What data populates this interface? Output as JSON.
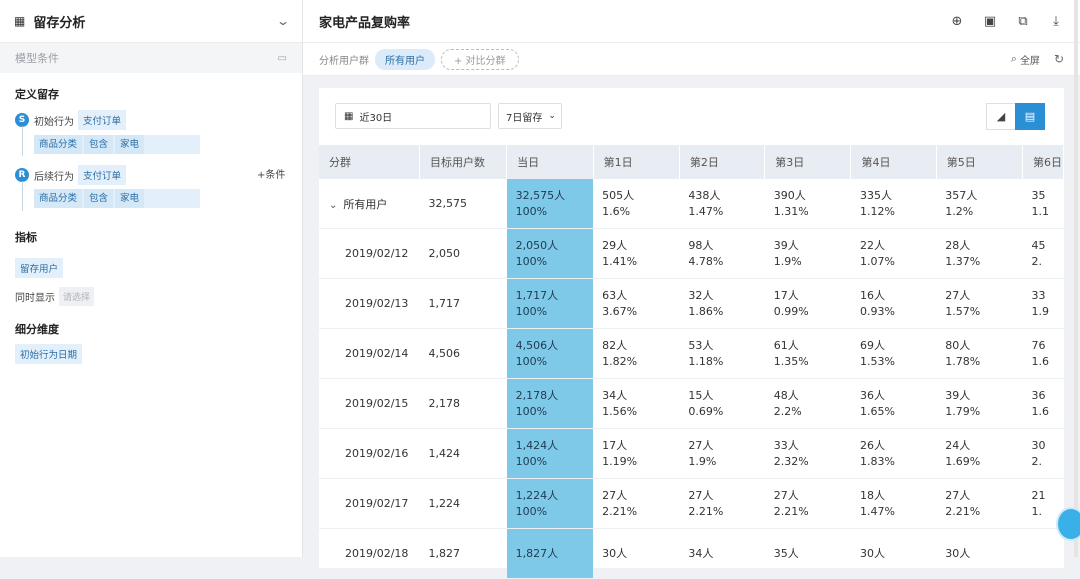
{
  "sidebar": {
    "title": "留存分析",
    "model_label": "模型条件",
    "define_label": "定义留存",
    "initial_badge": "S",
    "initial_label": "初始行为",
    "initial_event": "支付订单",
    "initial_filter": [
      "商品分类",
      "包含",
      "家电"
    ],
    "return_badge": "R",
    "return_label": "后续行为",
    "return_event": "支付订单",
    "add_condition": "+条件",
    "return_filter": [
      "商品分类",
      "包含",
      "家电"
    ],
    "metrics_label": "指标",
    "metric_tag": "留存用户",
    "also_show_label": "同时显示",
    "also_show_placeholder": "请选择",
    "breakdown_label": "细分维度",
    "breakdown_tag": "初始行为日期"
  },
  "header": {
    "title": "家电产品复购率"
  },
  "filterbar": {
    "group_label": "分析用户群",
    "group_pill": "所有用户",
    "compare_pill": "+ 对比分群",
    "fullscreen": "全屏"
  },
  "controls": {
    "date_range": "近30日",
    "retention_period": "7日留存"
  },
  "table": {
    "headers": [
      "分群",
      "目标用户数",
      "当日",
      "第1日",
      "第2日",
      "第3日",
      "第4日",
      "第5日",
      "第6日"
    ],
    "rows": [
      {
        "group": "所有用户",
        "users": "32,575",
        "cells": [
          [
            "32,575人",
            "100%"
          ],
          [
            "505人",
            "1.6%"
          ],
          [
            "438人",
            "1.47%"
          ],
          [
            "390人",
            "1.31%"
          ],
          [
            "335人",
            "1.12%"
          ],
          [
            "357人",
            "1.2%"
          ],
          [
            "35",
            "1.1"
          ]
        ]
      },
      {
        "group": "2019/02/12",
        "users": "2,050",
        "cells": [
          [
            "2,050人",
            "100%"
          ],
          [
            "29人",
            "1.41%"
          ],
          [
            "98人",
            "4.78%"
          ],
          [
            "39人",
            "1.9%"
          ],
          [
            "22人",
            "1.07%"
          ],
          [
            "28人",
            "1.37%"
          ],
          [
            "45",
            "2."
          ]
        ]
      },
      {
        "group": "2019/02/13",
        "users": "1,717",
        "cells": [
          [
            "1,717人",
            "100%"
          ],
          [
            "63人",
            "3.67%"
          ],
          [
            "32人",
            "1.86%"
          ],
          [
            "17人",
            "0.99%"
          ],
          [
            "16人",
            "0.93%"
          ],
          [
            "27人",
            "1.57%"
          ],
          [
            "33",
            "1.9"
          ]
        ]
      },
      {
        "group": "2019/02/14",
        "users": "4,506",
        "cells": [
          [
            "4,506人",
            "100%"
          ],
          [
            "82人",
            "1.82%"
          ],
          [
            "53人",
            "1.18%"
          ],
          [
            "61人",
            "1.35%"
          ],
          [
            "69人",
            "1.53%"
          ],
          [
            "80人",
            "1.78%"
          ],
          [
            "76",
            "1.6"
          ]
        ]
      },
      {
        "group": "2019/02/15",
        "users": "2,178",
        "cells": [
          [
            "2,178人",
            "100%"
          ],
          [
            "34人",
            "1.56%"
          ],
          [
            "15人",
            "0.69%"
          ],
          [
            "48人",
            "2.2%"
          ],
          [
            "36人",
            "1.65%"
          ],
          [
            "39人",
            "1.79%"
          ],
          [
            "36",
            "1.6"
          ]
        ]
      },
      {
        "group": "2019/02/16",
        "users": "1,424",
        "cells": [
          [
            "1,424人",
            "100%"
          ],
          [
            "17人",
            "1.19%"
          ],
          [
            "27人",
            "1.9%"
          ],
          [
            "33人",
            "2.32%"
          ],
          [
            "26人",
            "1.83%"
          ],
          [
            "24人",
            "1.69%"
          ],
          [
            "30",
            "2."
          ]
        ]
      },
      {
        "group": "2019/02/17",
        "users": "1,224",
        "cells": [
          [
            "1,224人",
            "100%"
          ],
          [
            "27人",
            "2.21%"
          ],
          [
            "27人",
            "2.21%"
          ],
          [
            "27人",
            "2.21%"
          ],
          [
            "18人",
            "1.47%"
          ],
          [
            "27人",
            "2.21%"
          ],
          [
            "21",
            "1."
          ]
        ]
      },
      {
        "group": "2019/02/18",
        "users": "1,827",
        "cells": [
          [
            "1,827人",
            ""
          ],
          [
            "30人",
            ""
          ],
          [
            "34人",
            ""
          ],
          [
            "35人",
            ""
          ],
          [
            "30人",
            ""
          ],
          [
            "30人",
            ""
          ],
          [
            "",
            ""
          ]
        ]
      }
    ]
  }
}
